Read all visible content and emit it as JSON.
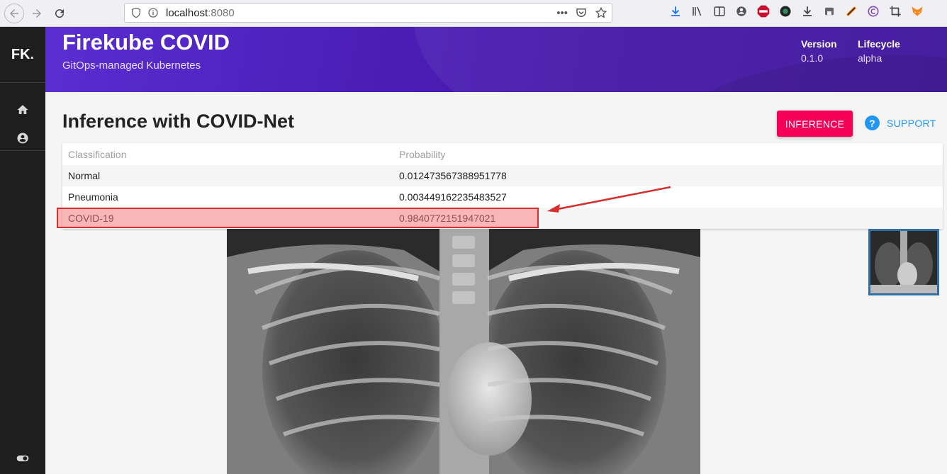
{
  "browser": {
    "url_host": "localhost",
    "url_port": ":8080",
    "more": "•••"
  },
  "sidebar": {
    "logo": "FK",
    "logo_dot": "."
  },
  "header": {
    "title": "Firekube COVID",
    "subtitle": "GitOps-managed Kubernetes",
    "version_label": "Version",
    "version_value": "0.1.0",
    "lifecycle_label": "Lifecycle",
    "lifecycle_value": "alpha"
  },
  "main": {
    "page_title": "Inference with COVID-Net",
    "inference_button": "INFERENCE",
    "support_button": "SUPPORT",
    "support_icon_glyph": "?",
    "table": {
      "headers": [
        "Classification",
        "Probability"
      ],
      "rows": [
        {
          "classification": "Normal",
          "probability": "0.012473567388951778"
        },
        {
          "classification": "Pneumonia",
          "probability": "0.003449162235483527"
        },
        {
          "classification": "COVID-19",
          "probability": "0.9840772151947021"
        }
      ]
    }
  },
  "colors": {
    "accent_pink": "#f50057",
    "support_blue": "#2196f3",
    "banner_purple": "#4b1fb8",
    "highlight_red": "#d32f2f"
  }
}
